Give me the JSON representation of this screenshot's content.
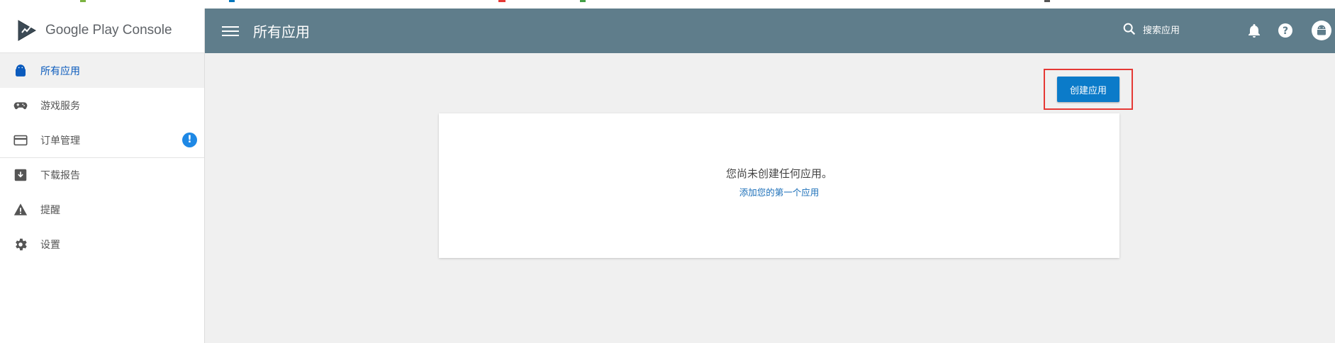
{
  "brand": {
    "name_google": "Google Play",
    "name_console": "Console"
  },
  "sidebar": {
    "items": [
      {
        "label": "所有应用",
        "icon": "android-icon",
        "active": true
      },
      {
        "label": "游戏服务",
        "icon": "gamepad-icon"
      },
      {
        "label": "订单管理",
        "icon": "credit-card-icon",
        "badge": "!"
      },
      {
        "label": "下载报告",
        "icon": "download-box-icon"
      },
      {
        "label": "提醒",
        "icon": "warning-icon"
      },
      {
        "label": "设置",
        "icon": "gear-icon"
      }
    ]
  },
  "header": {
    "title": "所有应用",
    "search_label": "搜索应用"
  },
  "main": {
    "create_button": "创建应用",
    "empty_message": "您尚未创建任何应用。",
    "add_first_link": "添加您的第一个应用"
  },
  "colors": {
    "topbar": "#5f7d8b",
    "accent": "#0b7bc9",
    "highlight": "#e53935",
    "badge": "#1e88e5"
  }
}
